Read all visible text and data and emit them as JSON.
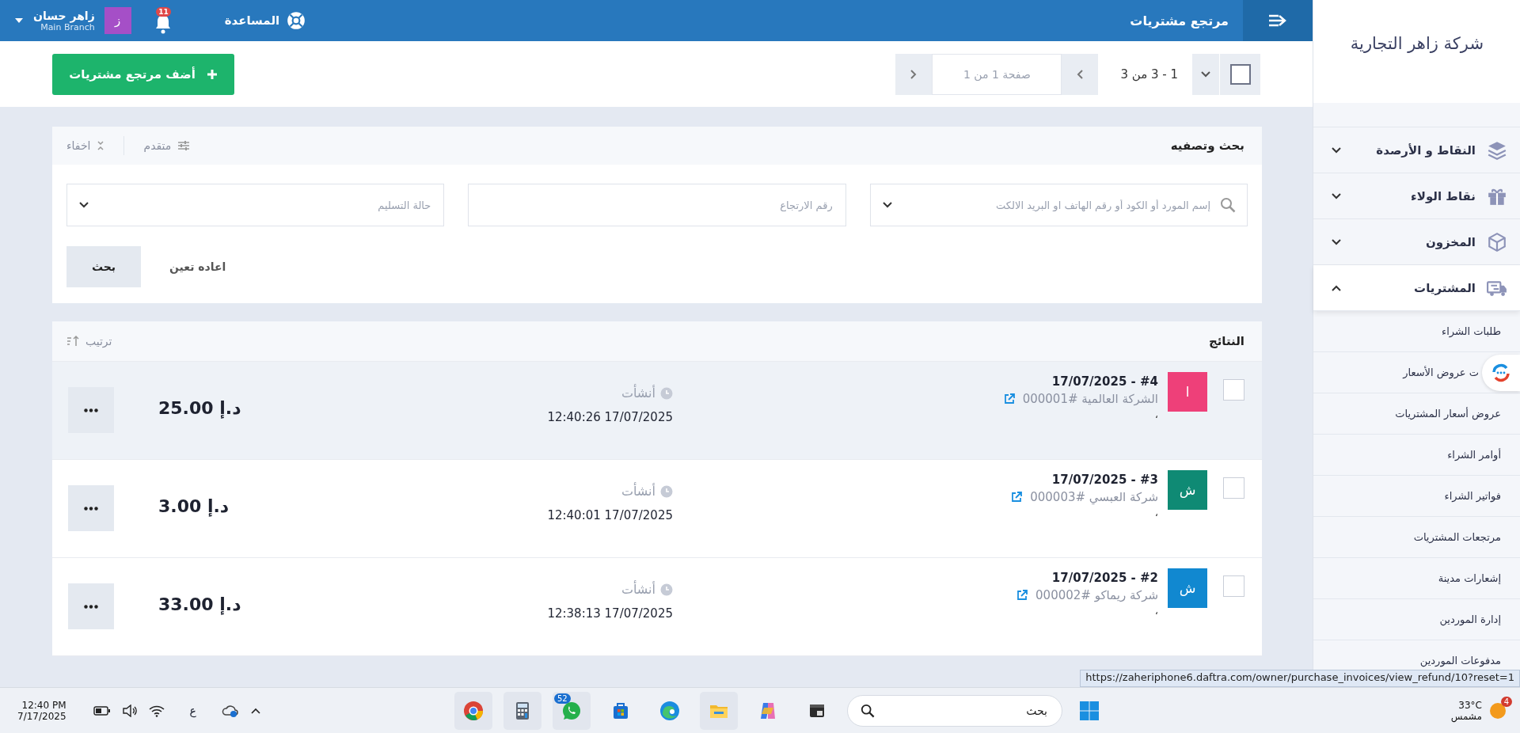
{
  "header": {
    "title": "مرتجع مشتريات",
    "help": "المساعدة",
    "notifications": "11",
    "user": {
      "initial": "ز",
      "name": "زاهر حسان",
      "branch": "Main Branch"
    }
  },
  "sidebar": {
    "company": "شركة زاهر التجارية",
    "items": [
      {
        "label": "النقاط و الأرصدة",
        "expanded": false
      },
      {
        "label": "نقاط الولاء",
        "expanded": false
      },
      {
        "label": "المخزون",
        "expanded": false
      },
      {
        "label": "المشتريات",
        "expanded": true,
        "children": [
          {
            "label": "طلبات الشراء"
          },
          {
            "label": "ت عروض الأسعار"
          },
          {
            "label": "عروض أسعار المشتريات"
          },
          {
            "label": "أوامر الشراء"
          },
          {
            "label": "فواتير الشراء"
          },
          {
            "label": "مرتجعات المشتريات"
          },
          {
            "label": "إشعارات مدينة"
          },
          {
            "label": "إدارة الموردين"
          },
          {
            "label": "مدفوعات الموردين"
          }
        ]
      }
    ]
  },
  "toolbar": {
    "select_all": {
      "checked": false
    },
    "range": "1 - 3 من 3",
    "page": {
      "placeholder": "صفحة 1 من 1"
    },
    "add_button": "أضف مرتجع مشتريات"
  },
  "search": {
    "title": "بحث وتصفيه",
    "advanced": "متقدم",
    "hide": "اخفاء",
    "fields": [
      {
        "kind": "search-select",
        "placeholder": "إسم المورد أو الكود أو رقم الهاتف او البريد الالكت"
      },
      {
        "kind": "text",
        "placeholder": "رقم الارتجاع"
      },
      {
        "kind": "select",
        "placeholder": "حالة التسليم"
      }
    ],
    "reset": "اعاده تعين",
    "submit": "بحث"
  },
  "results": {
    "title": "النتائج",
    "sort": "ترتيب",
    "rows": [
      {
        "checked": false,
        "hovered": true,
        "initial": "ا",
        "color": "#ee4079",
        "title": "#4 - 17/07/2025",
        "supplier": "الشركة العالمية #000001",
        "note": "،",
        "created_label": "أنشأت",
        "created": "12:40:26 17/07/2025",
        "amount": "25.00 د.إ"
      },
      {
        "checked": false,
        "hovered": false,
        "initial": "ش",
        "color": "#0f8a74",
        "title": "#3 - 17/07/2025",
        "supplier": "شركة العبسي #000003",
        "note": "،",
        "created_label": "أنشأت",
        "created": "12:40:01 17/07/2025",
        "amount": "3.00 د.إ"
      },
      {
        "checked": false,
        "hovered": false,
        "initial": "ش",
        "color": "#1188d0",
        "title": "#2 - 17/07/2025",
        "supplier": "شركة ريماكو #000002",
        "note": "،",
        "created_label": "أنشأت",
        "created": "12:38:13 17/07/2025",
        "amount": "33.00 د.إ"
      }
    ]
  },
  "status_url": "https://zaheriphone6.daftra.com/owner/purchase_invoices/view_refund/10?reset=1",
  "taskbar": {
    "time": "12:40 PM",
    "date": "7/17/2025",
    "language": "ع",
    "whatsapp_badge": "52",
    "search": {
      "placeholder": "بحث"
    },
    "weather": {
      "temperature": "33°C",
      "condition": "مشمس",
      "badge": "4"
    }
  }
}
